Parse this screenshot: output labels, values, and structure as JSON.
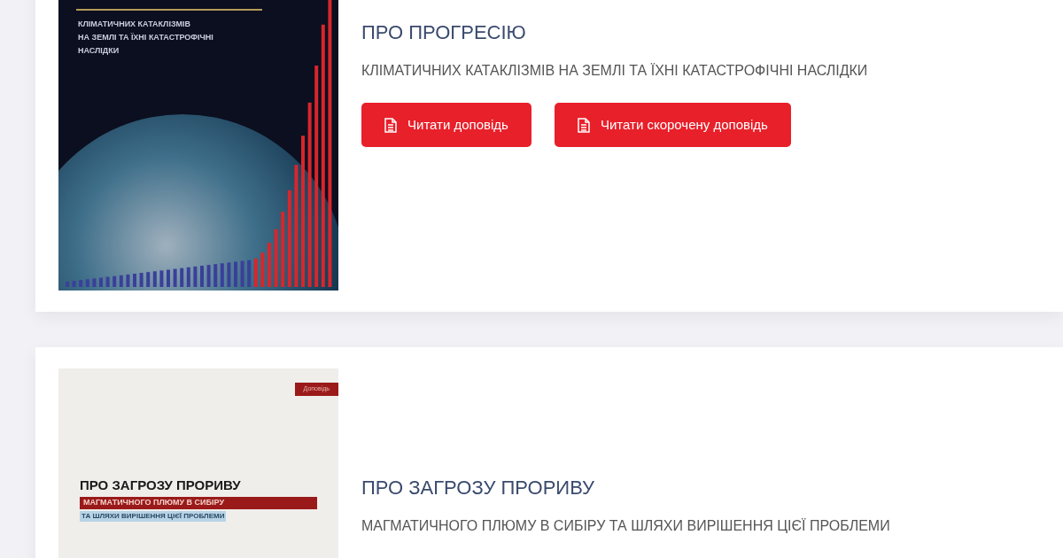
{
  "reports": [
    {
      "kind": "earth",
      "cover": {
        "lines": [
          "КЛІМАТИЧНИХ КАТАКЛІЗМІВ",
          "НА ЗЕМЛІ ТА ЇХНІ **КАТАСТРОФІЧНІ**",
          "НАСЛІДКИ"
        ]
      },
      "title": "ПРО ПРОГРЕСІЮ",
      "subtitle": "КЛІМАТИЧНИХ КАТАКЛІЗМІВ НА ЗЕМЛІ ТА ЇХНІ КАТАСТРОФІЧНІ НАСЛІДКИ",
      "buttons": [
        "Читати доповідь",
        "Читати скорочену доповідь"
      ]
    },
    {
      "kind": "plain",
      "cover": {
        "tag": "Доповідь",
        "lines": [
          "ПРО ЗАГРОЗУ ПРОРИВУ",
          "МАГМАТИЧНОГО ПЛЮМУ В СИБІРУ",
          "ТА ШЛЯХИ ВИРІШЕННЯ ЦІЄЇ ПРОБЛЕМИ"
        ]
      },
      "title": "ПРО ЗАГРОЗУ ПРОРИВУ",
      "subtitle": "МАГМАТИЧНОГО ПЛЮМУ В СИБІРУ ТА ШЛЯХИ ВИРІШЕННЯ ЦІЄЇ ПРОБЛЕМИ"
    }
  ]
}
